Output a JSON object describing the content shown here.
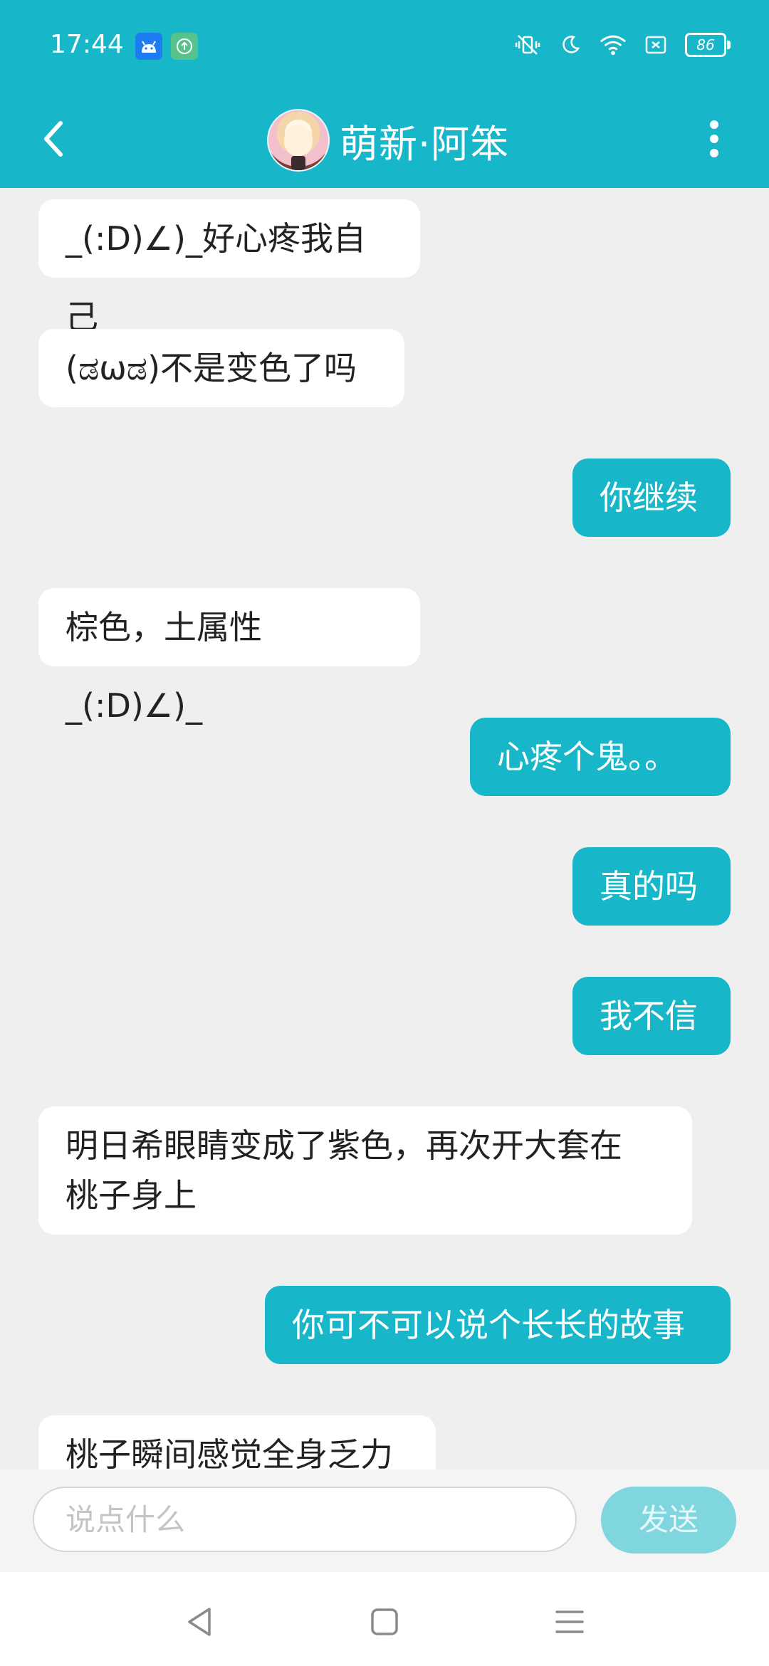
{
  "status_bar": {
    "time": "17:44",
    "battery": "86",
    "icons": [
      "android-icon",
      "upload-icon",
      "mute-vibrate-icon",
      "moon-icon",
      "wifi-icon",
      "sim-icon",
      "battery-icon"
    ]
  },
  "header": {
    "title": "萌新·阿笨",
    "back_icon": "back-arrow-icon",
    "more_icon": "more-vertical-icon"
  },
  "messages": [
    {
      "side": "left",
      "text": "_(:D)∠)_好心疼我自己"
    },
    {
      "side": "left",
      "text": "(ಡωಡ)不是变色了吗"
    },
    {
      "side": "right",
      "text": "你继续"
    },
    {
      "side": "left",
      "text": "棕色，土属性_(:D)∠)_"
    },
    {
      "side": "right",
      "text": "心疼个鬼。。"
    },
    {
      "side": "right",
      "text": "真的吗"
    },
    {
      "side": "right",
      "text": "我不信"
    },
    {
      "side": "left",
      "text": "明日希眼睛变成了紫色，再次开大套在\n桃子身上"
    },
    {
      "side": "right",
      "text": "你可不可以说个长长的故事"
    },
    {
      "side": "left",
      "text": "桃子瞬间感觉全身乏力"
    }
  ],
  "input": {
    "placeholder": "说点什么",
    "value": "",
    "send_label": "发送"
  },
  "colors": {
    "accent": "#17b6c8",
    "background": "#efefef",
    "send_disabled": "#7fd6df"
  }
}
